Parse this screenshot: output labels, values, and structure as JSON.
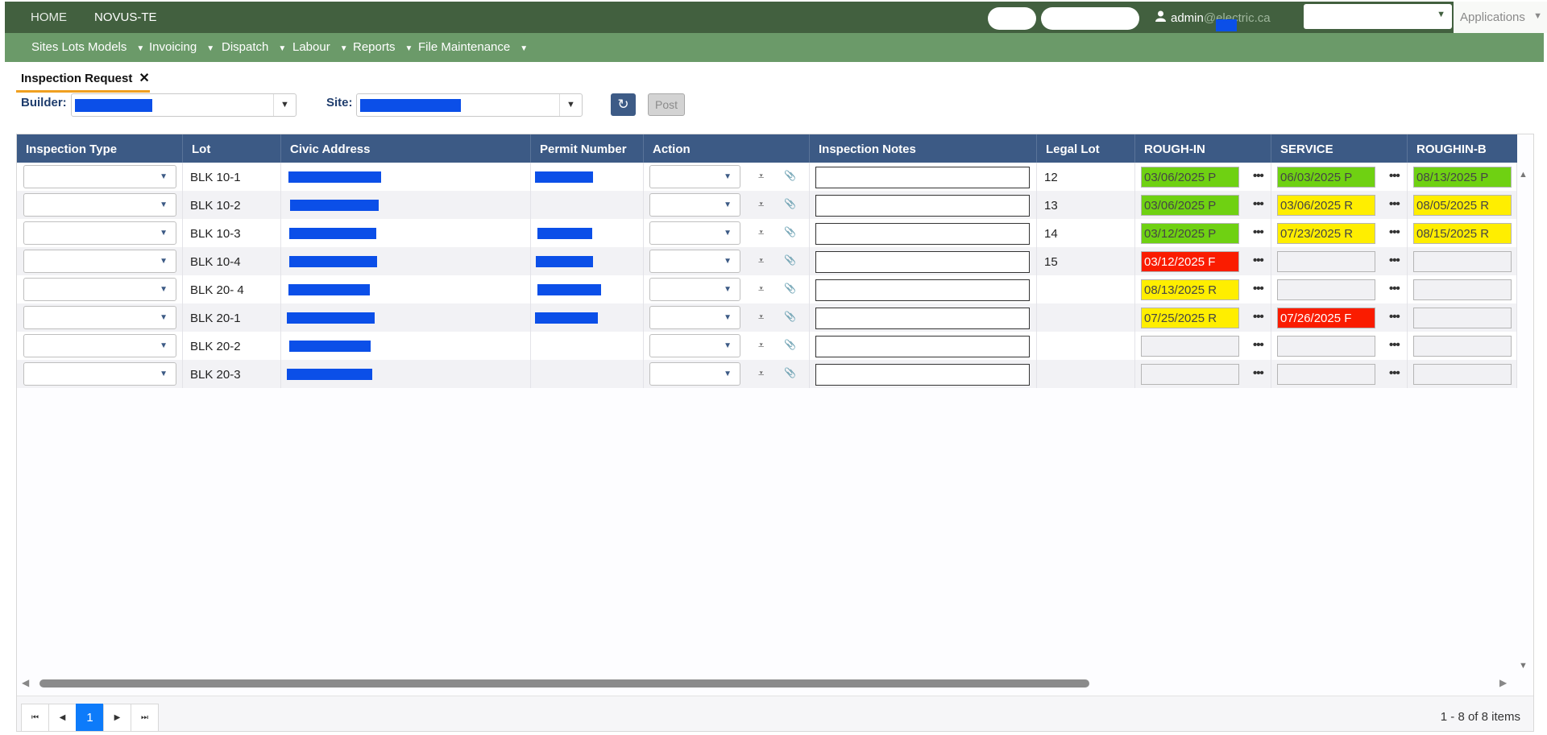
{
  "topbar": {
    "home": "HOME",
    "app": "NOVUS-TE",
    "user_name": "admin",
    "user_at": "@",
    "user_domain": "electric.ca",
    "applications": "Applications"
  },
  "menu": [
    {
      "label": "Sites Lots Models"
    },
    {
      "label": "Invoicing"
    },
    {
      "label": "Dispatch"
    },
    {
      "label": "Labour"
    },
    {
      "label": "Reports"
    },
    {
      "label": "File Maintenance"
    }
  ],
  "tab": {
    "label": "Inspection Request",
    "close": "✕"
  },
  "filters": {
    "builder_label": "Builder:",
    "site_label": "Site:",
    "post_label": "Post"
  },
  "grid": {
    "headers": [
      "Inspection Type",
      "Lot",
      "Civic Address",
      "Permit Number",
      "Action",
      "Inspection Notes",
      "Legal Lot",
      "ROUGH-IN",
      "SERVICE",
      "ROUGHIN-B"
    ],
    "rows": [
      {
        "lot": "BLK 10-1",
        "legal": "12",
        "rough": "03/06/2025 P",
        "service": "06/03/2025 P",
        "roughb": "08/13/2025 P"
      },
      {
        "lot": "BLK 10-2",
        "legal": "13",
        "rough": "03/06/2025 P",
        "service": "03/06/2025 R",
        "roughb": "08/05/2025 R"
      },
      {
        "lot": "BLK 10-3",
        "legal": "14",
        "rough": "03/12/2025 P",
        "service": "07/23/2025 R",
        "roughb": "08/15/2025 R"
      },
      {
        "lot": "BLK 10-4",
        "legal": "15",
        "rough": "03/12/2025 F",
        "service": "",
        "roughb": ""
      },
      {
        "lot": "BLK 20- 4",
        "legal": "",
        "rough": "08/13/2025 R",
        "service": "",
        "roughb": ""
      },
      {
        "lot": "BLK 20-1",
        "legal": "",
        "rough": "07/25/2025 R",
        "service": "07/26/2025 F",
        "roughb": ""
      },
      {
        "lot": "BLK 20-2",
        "legal": "",
        "rough": "",
        "service": "",
        "roughb": ""
      },
      {
        "lot": "BLK 20-3",
        "legal": "",
        "rough": "",
        "service": "",
        "roughb": ""
      }
    ]
  },
  "pager": {
    "current_page": "1",
    "info": "1 - 8 of 8 items"
  },
  "colors": {
    "topbar": "#42603f",
    "menubar": "#6b9a69",
    "header": "#3c5a85",
    "passed": "#6fd112",
    "requested": "#ffee00",
    "failed": "#fa1c00",
    "redaction": "#0b4fe8"
  },
  "icons": {
    "dropdown": "caret-down-icon",
    "refresh": "refresh-icon",
    "filter": "filter-icon",
    "attach": "paperclip-icon",
    "more": "ellipsis-icon"
  }
}
